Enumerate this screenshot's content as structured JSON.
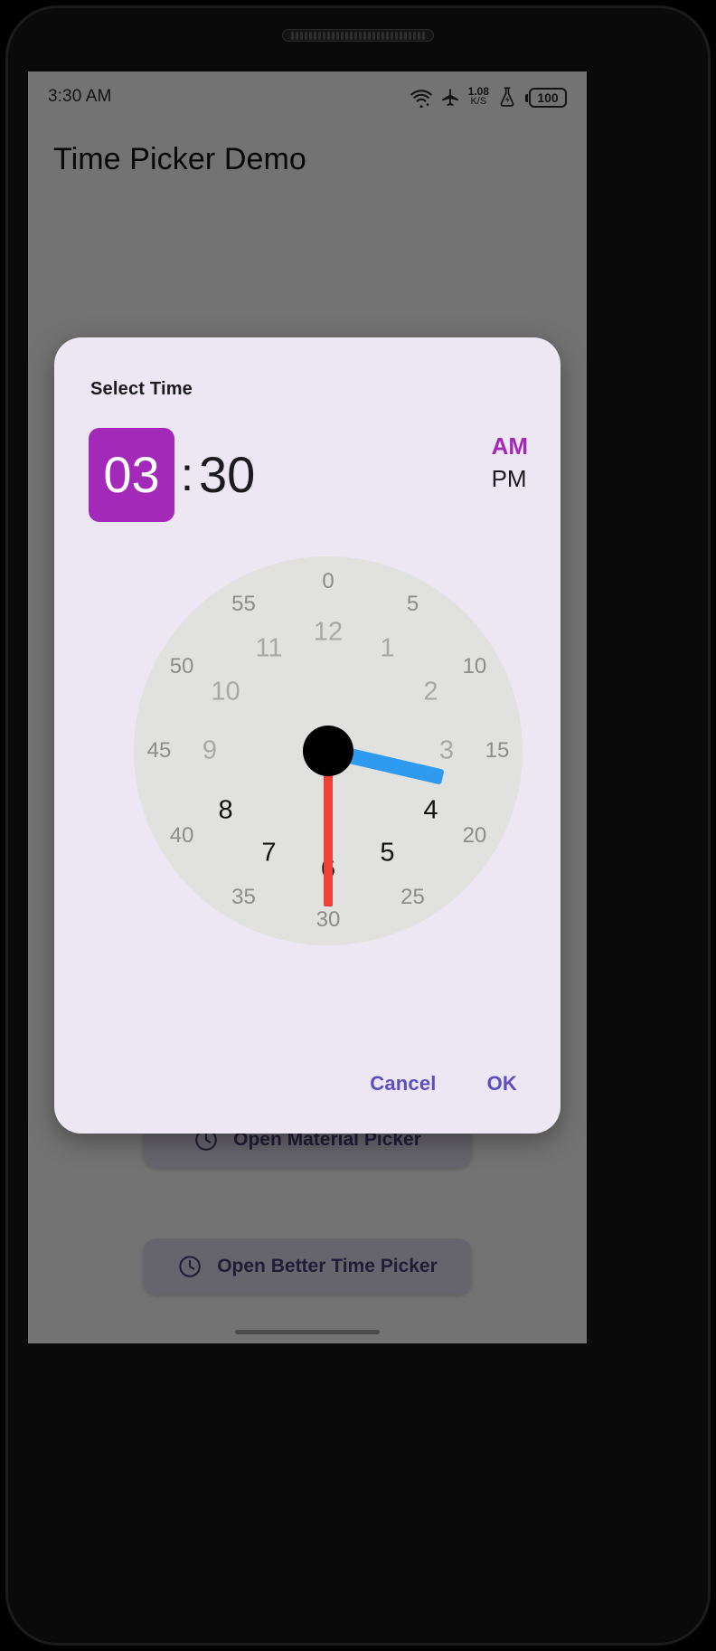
{
  "status_bar": {
    "time": "3:30 AM",
    "net_speed_value": "1.08",
    "net_speed_unit": "K/S",
    "battery_level": "100",
    "icons": {
      "wifi": "wifi-icon",
      "airplane": "airplane-mode-icon",
      "battery_saver": "battery-saver-flask-icon",
      "battery": "battery-icon"
    }
  },
  "app": {
    "title": "Time Picker Demo",
    "buttons": [
      {
        "label": "Open Material Picker",
        "icon": "clock-icon"
      },
      {
        "label": "Open Better Time Picker",
        "icon": "clock-icon"
      }
    ]
  },
  "dialog": {
    "title": "Select Time",
    "hour": "03",
    "separator": ":",
    "minute": "30",
    "period_selected": "AM",
    "period_options": [
      {
        "label": "AM",
        "selected": true
      },
      {
        "label": "PM",
        "selected": false
      }
    ],
    "actions": {
      "cancel": "Cancel",
      "ok": "OK"
    },
    "colors": {
      "surface": "#ece7f3",
      "hour_chip": "#a329b8",
      "period_selected": "#a329b8",
      "action_text": "#5b4ec0",
      "dial_face": "#e1e1df",
      "hour_hand": "#2e9bf0",
      "minute_hand": "#ef4136",
      "center_dot": "#000000"
    }
  },
  "clock": {
    "selected_hour": 3,
    "selected_minute": 30,
    "hour_hand_angle_deg": 13,
    "minute_hand_angle_deg": 90,
    "minute_ring": [
      {
        "label": "0",
        "angle": 0
      },
      {
        "label": "5",
        "angle": 30
      },
      {
        "label": "10",
        "angle": 60
      },
      {
        "label": "15",
        "angle": 90
      },
      {
        "label": "20",
        "angle": 120
      },
      {
        "label": "25",
        "angle": 150
      },
      {
        "label": "30",
        "angle": 180
      },
      {
        "label": "35",
        "angle": 210
      },
      {
        "label": "40",
        "angle": 240
      },
      {
        "label": "45",
        "angle": 270
      },
      {
        "label": "50",
        "angle": 300
      },
      {
        "label": "55",
        "angle": 330
      }
    ],
    "hour_ring": [
      {
        "label": "12",
        "angle": 0,
        "dark": false
      },
      {
        "label": "1",
        "angle": 30,
        "dark": false
      },
      {
        "label": "2",
        "angle": 60,
        "dark": false
      },
      {
        "label": "3",
        "angle": 90,
        "dark": false
      },
      {
        "label": "4",
        "angle": 120,
        "dark": true
      },
      {
        "label": "5",
        "angle": 150,
        "dark": true
      },
      {
        "label": "6",
        "angle": 180,
        "dark": true
      },
      {
        "label": "7",
        "angle": 210,
        "dark": true
      },
      {
        "label": "8",
        "angle": 240,
        "dark": true
      },
      {
        "label": "9",
        "angle": 270,
        "dark": false
      },
      {
        "label": "10",
        "angle": 300,
        "dark": false
      },
      {
        "label": "11",
        "angle": 330,
        "dark": false
      }
    ]
  }
}
